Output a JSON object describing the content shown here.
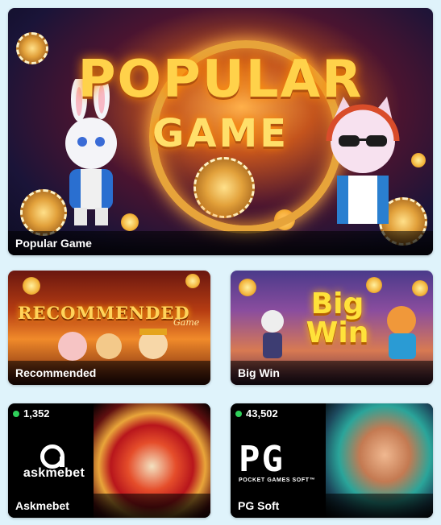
{
  "cards": {
    "hero": {
      "title_line1": "POPULAR",
      "title_line2": "GAME",
      "label": "Popular Game"
    },
    "recommended": {
      "art_title": "RECOMMENDED",
      "art_subtitle": "Game",
      "label": "Recommended"
    },
    "bigwin": {
      "art_title_1": "Big",
      "art_title_2": "Win",
      "label": "Big Win"
    },
    "askmebet": {
      "count": "1,352",
      "logo_text": "askmebet",
      "label": "Askmebet"
    },
    "pgsoft": {
      "count": "43,502",
      "logo_text": "PG",
      "logo_subtext": "POCKET GAMES SOFT™",
      "label": "PG Soft"
    }
  },
  "colors": {
    "page_background": "#dff3fb",
    "online_dot": "#2fd05a",
    "gold": "#ffd24a"
  },
  "icons": [
    "online-status-dot-icon",
    "askmebet-logo-icon",
    "pg-soft-logo-icon"
  ]
}
